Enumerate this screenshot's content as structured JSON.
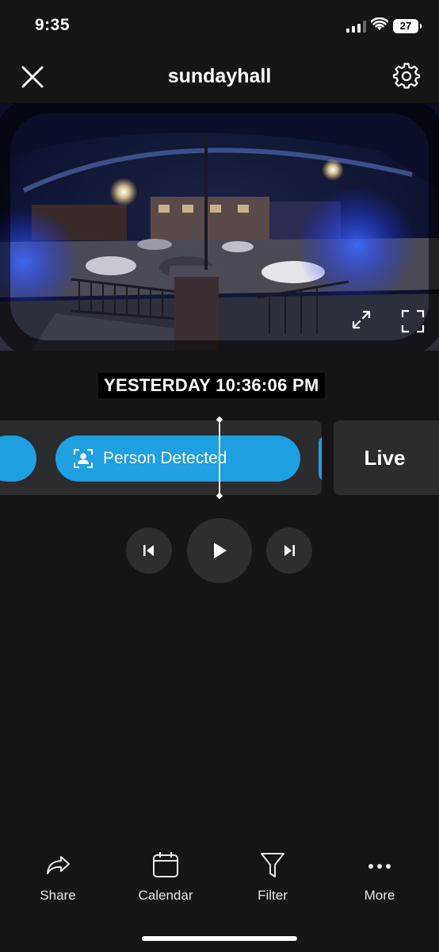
{
  "status_bar": {
    "time": "9:35",
    "battery": "27"
  },
  "header": {
    "title": "sundayhall"
  },
  "timestamp": "YESTERDAY 10:36:06 PM",
  "timeline": {
    "event_label": "Person Detected",
    "live_label": "Live"
  },
  "bottom_nav": [
    {
      "label": "Share",
      "icon": "share-icon"
    },
    {
      "label": "Calendar",
      "icon": "calendar-icon"
    },
    {
      "label": "Filter",
      "icon": "filter-icon"
    },
    {
      "label": "More",
      "icon": "more-icon"
    }
  ],
  "colors": {
    "accent": "#1ea0e1",
    "background": "#151515",
    "panel": "#2b2c2e"
  }
}
